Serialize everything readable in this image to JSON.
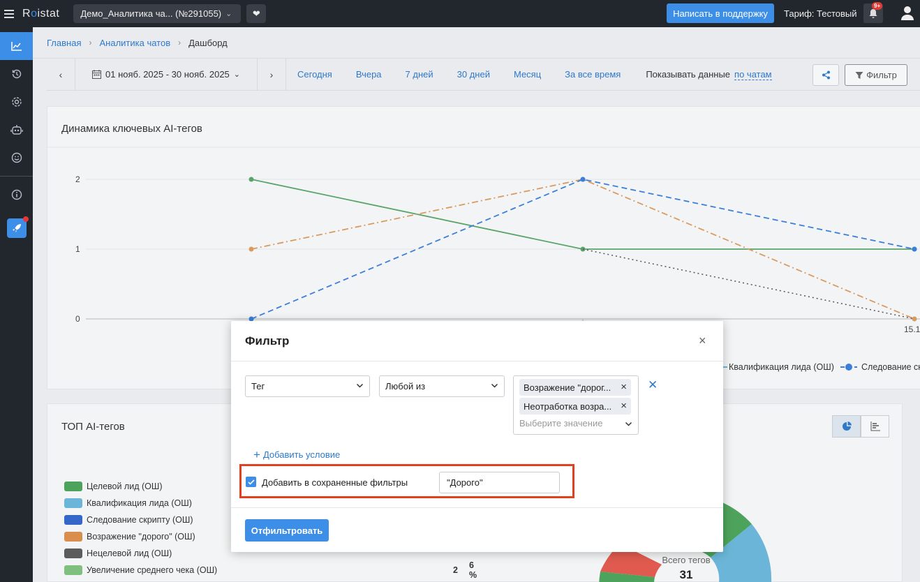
{
  "topbar": {
    "logo_prefix": "R",
    "logo_dot": "o",
    "logo_suffix": "istat",
    "project": "Демо_Аналитика ча... (№291055)",
    "support_button": "Написать в поддержку",
    "tariff": "Тариф: Тестовый",
    "notifications_badge": "9+"
  },
  "breadcrumb": {
    "home": "Главная",
    "section": "Аналитика чатов",
    "current": "Дашборд"
  },
  "datebar": {
    "range": "01 нояб. 2025 - 30 нояб. 2025",
    "quick": [
      "Сегодня",
      "Вчера",
      "7 дней",
      "30 дней",
      "Месяц",
      "За все время"
    ],
    "show_data_label": "Показывать данные",
    "show_data_value": "по чатам",
    "filter_button": "Фильтр"
  },
  "chart_card": {
    "title": "Динамика ключевых AI-тегов",
    "legend_visible": [
      "Квалификация лида (ОШ)",
      "Следование ск"
    ]
  },
  "chart_data": {
    "type": "line",
    "title": "Динамика ключевых AI-тегов",
    "x_tick_labels_visible": [
      "15.1"
    ],
    "ylim": [
      0,
      2
    ],
    "y_ticks": [
      0,
      1,
      2
    ],
    "grid": true,
    "series": [
      {
        "name": "",
        "color": "#5aa469",
        "style": "solid",
        "values": [
          2,
          1,
          1
        ]
      },
      {
        "name": "",
        "color": "#d99a60",
        "style": "dashdot",
        "values": [
          1,
          2,
          0
        ]
      },
      {
        "name": "",
        "color": "#3c7edb",
        "style": "dashed",
        "values": [
          0,
          2,
          1
        ]
      },
      {
        "name": "",
        "color": "#555555",
        "style": "dotted",
        "values": [
          null,
          1,
          0
        ]
      }
    ]
  },
  "top_card": {
    "title": "ТОП AI-тегов",
    "tags": [
      {
        "label": "Целевой лид (ОШ)",
        "color": "#4ea35c",
        "count": "",
        "pct": ""
      },
      {
        "label": "Квалификация лида (ОШ)",
        "color": "#6bb6d8",
        "count": "",
        "pct": ""
      },
      {
        "label": "Следование скрипту (ОШ)",
        "color": "#3567c9",
        "count": "",
        "pct": ""
      },
      {
        "label": "Возражение \"дорого\" (ОШ)",
        "color": "#d98e4d",
        "count": "",
        "pct": ""
      },
      {
        "label": "Нецелевой лид (ОШ)",
        "color": "#5c5c5c",
        "count": "",
        "pct": ""
      },
      {
        "label": "Увеличение среднего чека (ОШ)",
        "color": "#7fc07f",
        "count": "2",
        "pct": "6 %"
      }
    ],
    "donut_label": "Всего тегов",
    "donut_value": "31"
  },
  "modal": {
    "title": "Фильтр",
    "field": "Тег",
    "operator": "Любой из",
    "chips": [
      "Возражение \"дорого\" (ОШ)",
      "Неотработка возражений (ОШ)"
    ],
    "chip_display": [
      "Возражение \"дорог...",
      "Неотработка возра..."
    ],
    "value_placeholder": "Выберите значение",
    "add_condition": "Добавить условие",
    "save_checkbox_label": "Добавить в сохраненные фильтры",
    "save_name": "\"Дорого\"",
    "submit": "Отфильтровать"
  }
}
